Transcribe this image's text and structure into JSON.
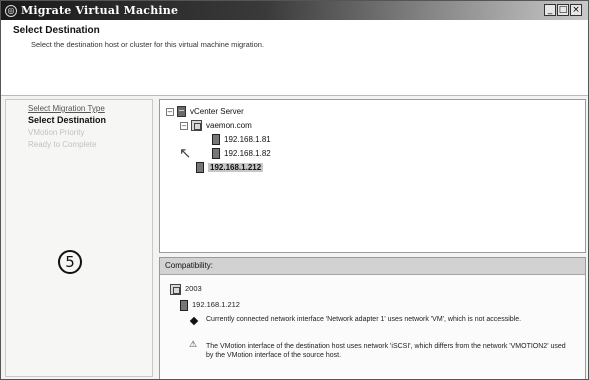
{
  "window": {
    "title": "Migrate Virtual Machine",
    "controls": [
      "_",
      "□",
      "×"
    ]
  },
  "header": {
    "title": "Select Destination",
    "subtitle": "Select the destination host or cluster for this virtual machine migration."
  },
  "wizard_nav": {
    "items": [
      {
        "label": "Select Migration Type",
        "state": "link"
      },
      {
        "label": "Select Destination",
        "state": "current"
      },
      {
        "label": "VMotion Priority",
        "state": "disabled"
      },
      {
        "label": "Ready to Complete",
        "state": "disabled"
      }
    ],
    "callout_number": "⑤"
  },
  "tree": {
    "root": {
      "label": "vCenter Server",
      "expander": "−",
      "icon": "server-icon"
    },
    "datacenter": {
      "label": "vaemon.com",
      "expander": "−",
      "icon": "datacenter-icon"
    },
    "hosts": [
      {
        "label": "192.168.1.81",
        "icon": "host-icon"
      },
      {
        "label": "192.168.1.82",
        "icon": "host-icon"
      },
      {
        "label": "192.168.1.212",
        "icon": "host-icon",
        "selected": true
      }
    ]
  },
  "compatibility": {
    "header": "Compatibility:",
    "group_label": "2003",
    "host_label": "192.168.1.212",
    "messages": [
      {
        "type": "error",
        "icon": "error-diamond-icon",
        "text": "Currently connected network interface 'Network adapter 1' uses network 'VM', which is not accessible."
      },
      {
        "type": "warning",
        "icon": "warning-icon",
        "text": "The VMotion interface of the destination host uses network 'iSCSI', which differs from the network 'VMOTION2' used by the VMotion interface of the source host."
      }
    ]
  }
}
